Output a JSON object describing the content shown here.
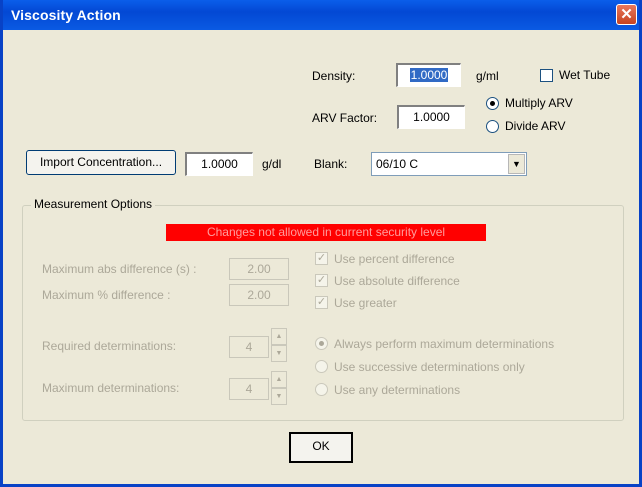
{
  "window": {
    "title": "Viscosity Action",
    "close_glyph": "✕"
  },
  "density": {
    "label": "Density:",
    "value": "1.0000",
    "unit": "g/ml"
  },
  "wet_tube": {
    "label": "Wet Tube",
    "checked": false
  },
  "arv": {
    "label": "ARV Factor:",
    "value": "1.0000",
    "multiply_label": "Multiply ARV",
    "divide_label": "Divide ARV",
    "selected": "multiply"
  },
  "import": {
    "button_label": "Import Concentration...",
    "value": "1.0000",
    "unit": "g/dl"
  },
  "blank": {
    "label": "Blank:",
    "value": "06/10 C"
  },
  "measurement": {
    "group_title": "Measurement Options",
    "warning": "Changes not allowed in current security level",
    "max_abs_label": "Maximum abs difference (s) :",
    "max_abs_value": "2.00",
    "max_pct_label": "Maximum % difference :",
    "max_pct_value": "2.00",
    "use_percent_label": "Use percent difference",
    "use_absolute_label": "Use absolute difference",
    "use_greater_label": "Use greater",
    "required_label": "Required determinations:",
    "required_value": "4",
    "maximum_label": "Maximum determinations:",
    "maximum_value": "4",
    "always_label": "Always perform maximum determinations",
    "successive_label": "Use successive determinations only",
    "any_label": "Use any determinations"
  },
  "ok_label": "OK",
  "colors": {
    "titlebar": "#0a5eea",
    "warning_bg": "#ff0000",
    "dialog_bg": "#ece9d8"
  }
}
